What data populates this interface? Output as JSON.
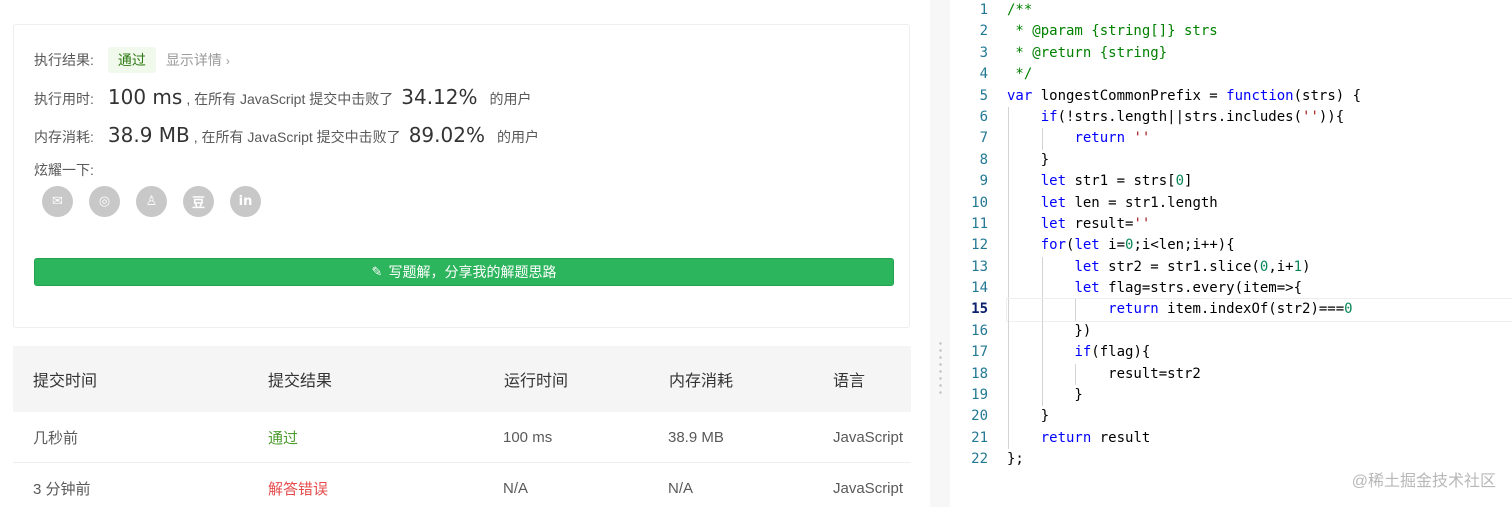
{
  "result": {
    "status_label": "执行结果:",
    "status_value": "通过",
    "details_link": "显示详情",
    "runtime_label": "执行用时:",
    "runtime_value": "100 ms",
    "runtime_text": ", 在所有 JavaScript 提交中击败了",
    "runtime_pct": "34.12%",
    "runtime_suffix": "的用户",
    "memory_label": "内存消耗:",
    "memory_value": "38.9 MB",
    "memory_text": ", 在所有 JavaScript 提交中击败了",
    "memory_pct": "89.02%",
    "memory_suffix": "的用户",
    "share_label": "炫耀一下:",
    "share_icons": [
      "wechat-icon",
      "weibo-icon",
      "qq-icon",
      "douban-icon",
      "linkedin-icon"
    ],
    "share_glyphs": [
      "✉",
      "◎",
      "♙",
      "豆",
      "in"
    ],
    "write_button": "写题解，分享我的解题思路"
  },
  "submissions": {
    "headers": [
      "提交时间",
      "提交结果",
      "运行时间",
      "内存消耗",
      "语言"
    ],
    "rows": [
      {
        "time": "几秒前",
        "result": "通过",
        "runtime": "100 ms",
        "memory": "38.9 MB",
        "lang": "JavaScript"
      },
      {
        "time": "3 分钟前",
        "result": "解答错误",
        "runtime": "N/A",
        "memory": "N/A",
        "lang": "JavaScript"
      }
    ]
  },
  "editor": {
    "current_line": 15,
    "lines": [
      "/**",
      " * @param {string[]} strs",
      " * @return {string}",
      " */",
      "var longestCommonPrefix = function(strs) {",
      "    if(!strs.length||strs.includes('')){",
      "        return ''",
      "    }",
      "    let str1 = strs[0]",
      "    let len = str1.length",
      "    let result=''",
      "    for(let i=0;i<len;i++){",
      "        let str2 = str1.slice(0,i+1)",
      "        let flag=strs.every(item=>{",
      "            return item.indexOf(str2)===0",
      "        })",
      "        if(flag){",
      "            result=str2",
      "        }",
      "    }",
      "    return result",
      "};"
    ]
  },
  "watermark": "@稀土掘金技术社区",
  "colors": {
    "accent_green": "#2db55d",
    "pass_text": "#4c9c2e",
    "error_text": "#e64c4c"
  }
}
